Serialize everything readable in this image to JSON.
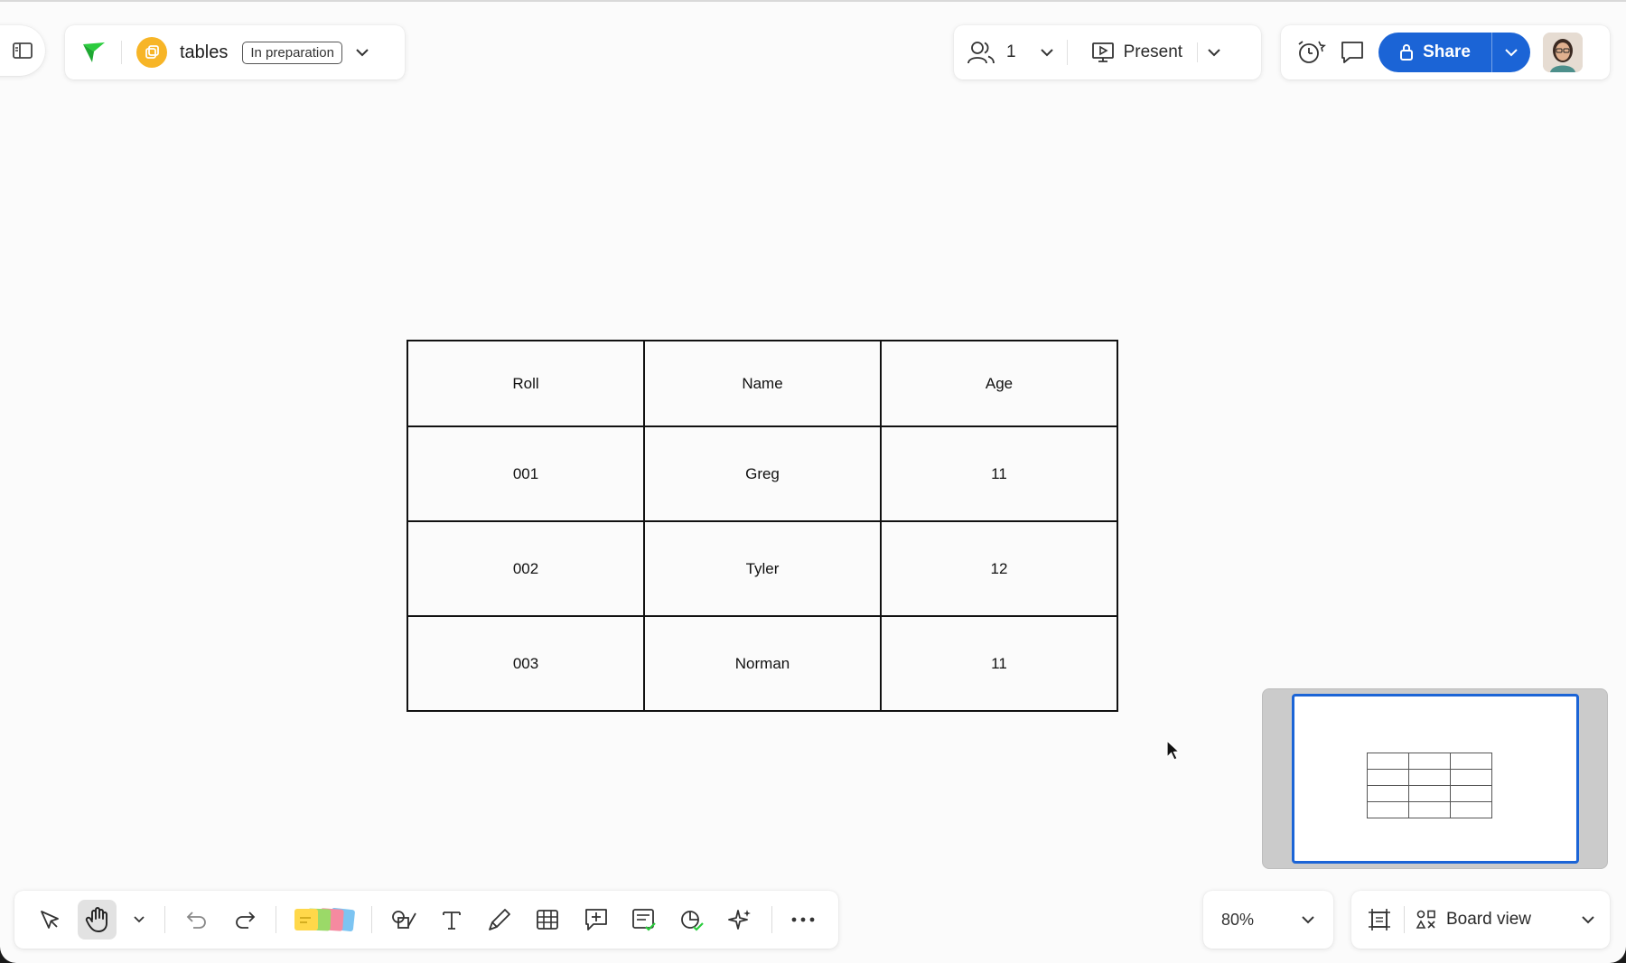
{
  "board": {
    "name": "tables",
    "status": "In preparation"
  },
  "collaboration": {
    "user_count": "1",
    "present_label": "Present",
    "share_label": "Share"
  },
  "table": {
    "headers": [
      "Roll",
      "Name",
      "Age"
    ],
    "rows": [
      [
        "001",
        "Greg",
        "11"
      ],
      [
        "002",
        "Tyler",
        "12"
      ],
      [
        "003",
        "Norman",
        "11"
      ]
    ]
  },
  "toolbar": {
    "tools": [
      "select-tool",
      "hand-tool",
      "tools-dropdown",
      "undo",
      "redo",
      "sticky-notes",
      "shapes",
      "text",
      "pen",
      "table",
      "comment",
      "card",
      "diagram",
      "ai-assist",
      "more"
    ],
    "active_tool": "hand-tool"
  },
  "zoom": {
    "level": "80%"
  },
  "view": {
    "label": "Board view"
  },
  "colors": {
    "accent": "#1b64d6",
    "board_icon": "#f7b527",
    "logo_green": "#2bcc3d"
  }
}
